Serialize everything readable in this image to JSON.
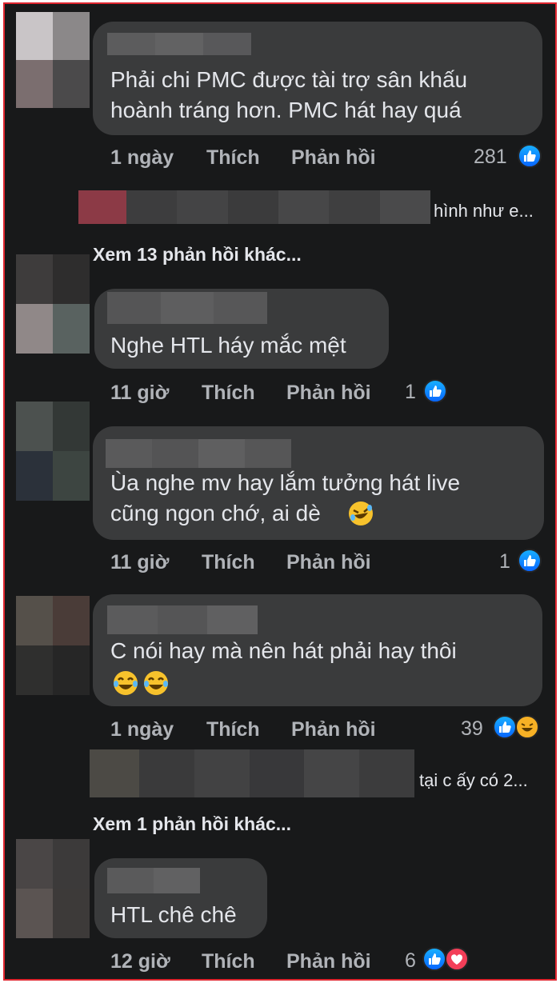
{
  "colors": {
    "background": "#18191a",
    "bubble": "#3a3b3c",
    "text": "#e4e6eb",
    "meta": "#b0b3b8",
    "like": "#0866ff",
    "love": "#f33e58",
    "haha": "#f7b125",
    "frame_border": "#e0262f"
  },
  "comments": [
    {
      "lines": [
        "Phải chi PMC được tài trợ sân khấu",
        "hoành tráng hơn. PMC hát hay quá"
      ],
      "time": "1 ngày",
      "like_label": "Thích",
      "reply_label": "Phản hồi",
      "reaction_count": "281",
      "reactions": [
        "like-icon"
      ],
      "reply_preview": "hình như e...",
      "more_replies": "Xem 13 phản hồi khác..."
    },
    {
      "lines": [
        "Nghe HTL háy mắc mệt"
      ],
      "time": "11 giờ",
      "like_label": "Thích",
      "reply_label": "Phản hồi",
      "reaction_count": "1",
      "reactions": [
        "like-icon"
      ]
    },
    {
      "lines": [
        "Ùa nghe mv hay lắm tưởng hát live",
        "cũng ngon chớ, ai dè"
      ],
      "emoji": [
        "rofl-emoji"
      ],
      "time": "11 giờ",
      "like_label": "Thích",
      "reply_label": "Phản hồi",
      "reaction_count": "1",
      "reactions": [
        "like-icon"
      ]
    },
    {
      "lines": [
        "C nói hay mà nên hát phải hay thôi"
      ],
      "emoji": [
        "joy-emoji",
        "joy-emoji"
      ],
      "time": "1 ngày",
      "like_label": "Thích",
      "reply_label": "Phản hồi",
      "reaction_count": "39",
      "reactions": [
        "like-icon",
        "haha-icon"
      ],
      "reply_preview": "tại c ấy có 2...",
      "more_replies": "Xem 1 phản hồi khác..."
    },
    {
      "lines": [
        "HTL chê chê"
      ],
      "time": "12 giờ",
      "like_label": "Thích",
      "reply_label": "Phản hồi",
      "reaction_count": "6",
      "reactions": [
        "like-icon",
        "heart-icon"
      ]
    }
  ]
}
